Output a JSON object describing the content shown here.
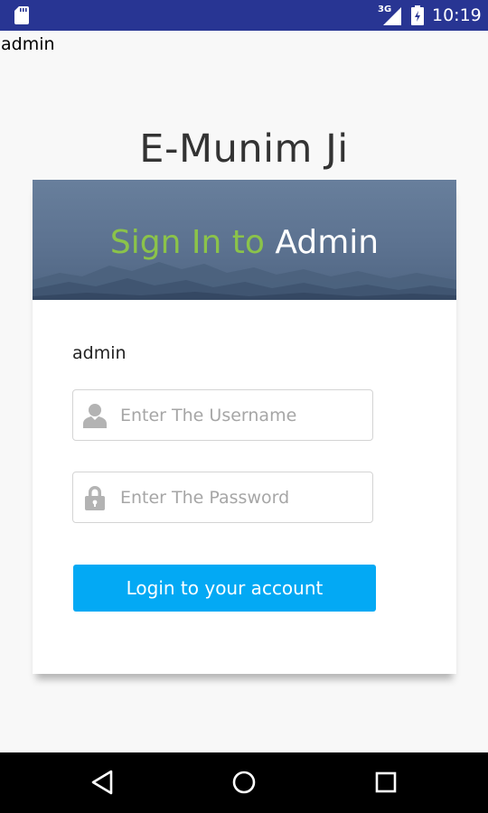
{
  "status_bar": {
    "network": "3G",
    "time": "10:19",
    "icons": [
      "sd-card-icon",
      "signal-icon",
      "battery-icon"
    ],
    "background": "#283593"
  },
  "app": {
    "label": "admin",
    "title": "E-Munim Ji"
  },
  "banner": {
    "title_prefix": "Sign In to",
    "title_suffix": "Admin",
    "prefix_color": "#8bc34a",
    "suffix_color": "#ffffff"
  },
  "form": {
    "caption": "admin",
    "username": {
      "placeholder": "Enter The Username",
      "value": "",
      "icon": "user-icon"
    },
    "password": {
      "placeholder": "Enter The Password",
      "value": "",
      "icon": "lock-icon"
    },
    "submit_label": "Login to your account",
    "accent": "#03a9f4"
  },
  "nav_bar": {
    "buttons": [
      "back-icon",
      "home-icon",
      "recents-icon"
    ]
  }
}
